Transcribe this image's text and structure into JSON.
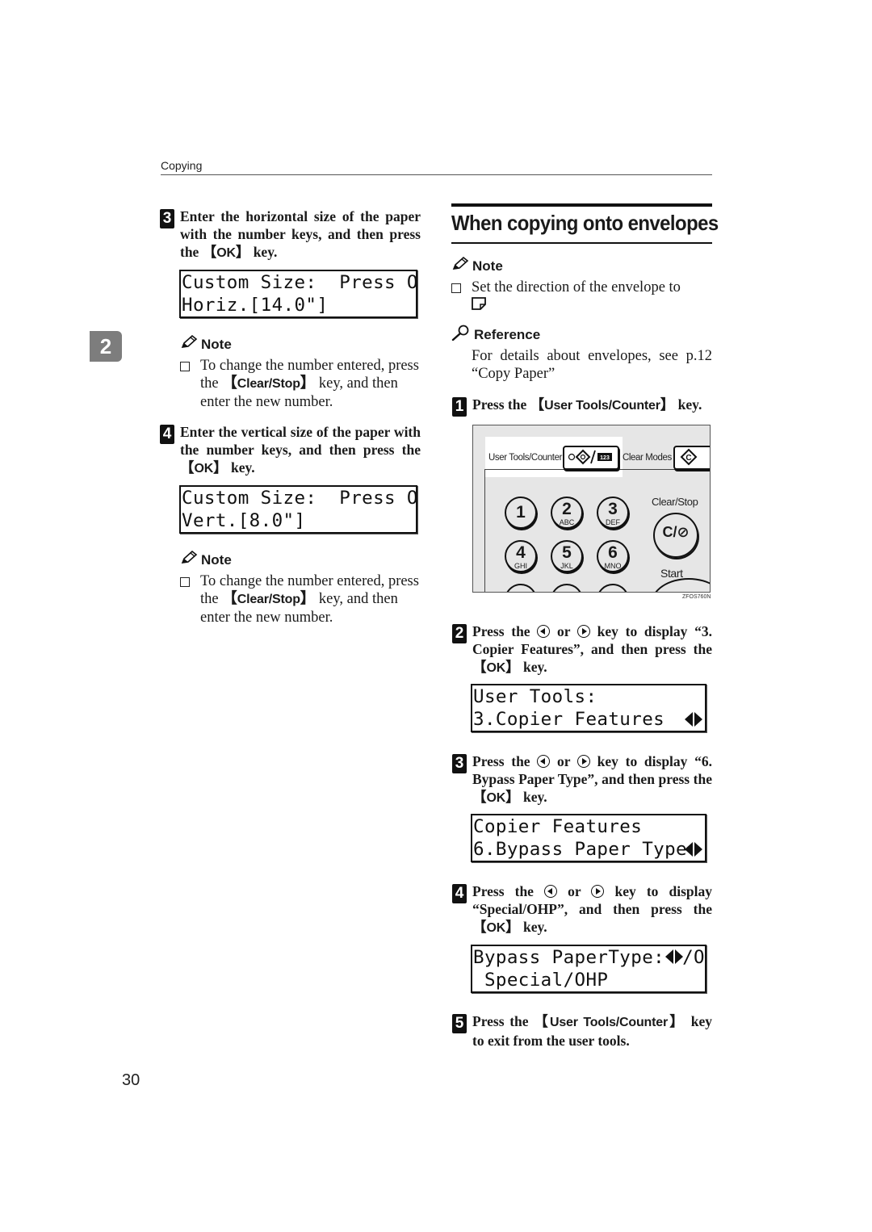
{
  "header": {
    "running_title": "Copying",
    "chapter_tab": "2"
  },
  "left_column": {
    "step3": {
      "number": "3",
      "text_before": "Enter the horizontal size of the paper with the number keys, and then press the ",
      "key": "OK",
      "text_after": " key.",
      "lcd": {
        "line1": "Custom Size:  Press OK",
        "line2": "Horiz.[14.0\"]"
      }
    },
    "note1": {
      "title": "Note",
      "text_before": "To change the number entered, press the ",
      "key": "Clear/Stop",
      "text_after": " key, and then enter the new number."
    },
    "step4": {
      "number": "4",
      "text_before": "Enter the vertical size of the paper with the number keys, and then press the ",
      "key": "OK",
      "text_after": " key.",
      "lcd": {
        "line1": "Custom Size:  Press OK",
        "line2": "Vert.[8.0\"]"
      }
    },
    "note2": {
      "title": "Note",
      "text_before": "To change the number entered, press the ",
      "key": "Clear/Stop",
      "text_after": " key, and then enter the new number."
    }
  },
  "right_column": {
    "section_title": "When copying onto envelopes",
    "note": {
      "title": "Note",
      "text": "Set the direction of the envelope to",
      "icon": "envelope-orientation-icon"
    },
    "reference": {
      "title": "Reference",
      "text": "For details about envelopes, see p.12 “Copy Paper”"
    },
    "step1": {
      "number": "1",
      "text_before": "Press the ",
      "key": "User Tools/Counter",
      "text_after": " key."
    },
    "panel": {
      "user_tools_label": "User Tools/Counter",
      "counter_badge": "123",
      "clear_modes_label": "Clear Modes",
      "clear_stop_label": "Clear/Stop",
      "clear_stop_key": "C/⊘",
      "start_label": "Start",
      "figure_id": "ZFOS760N",
      "keys": [
        {
          "n": "1",
          "l": ""
        },
        {
          "n": "2",
          "l": "ABC"
        },
        {
          "n": "3",
          "l": "DEF"
        },
        {
          "n": "4",
          "l": "GHI"
        },
        {
          "n": "5",
          "l": "JKL"
        },
        {
          "n": "6",
          "l": "MNO"
        }
      ]
    },
    "step2": {
      "number": "2",
      "text_a": "Press the ",
      "text_b": " or ",
      "text_c": " key to display “3. Copier Features”, and then press the ",
      "key": "OK",
      "text_after": " key.",
      "lcd": {
        "line1": "User Tools:",
        "line2": "3.Copier Features  "
      }
    },
    "step3": {
      "number": "3",
      "text_a": "Press the ",
      "text_b": " or ",
      "text_c": " key to display “6. Bypass Paper Type”, and then press the ",
      "key": "OK",
      "text_after": " key.",
      "lcd": {
        "line1": "Copier Features",
        "line2": "6.Bypass Paper Type "
      }
    },
    "step4": {
      "number": "4",
      "text_a": "Press the ",
      "text_b": " or ",
      "text_c": " key to display “Special/OHP”, and then press the ",
      "key": "OK",
      "text_after": " key.",
      "lcd": {
        "line1a": "Bypass PaperType:",
        "line1b": "/OK",
        "line2": " Special/OHP"
      }
    },
    "step5": {
      "number": "5",
      "text_before": "Press the ",
      "key": "User Tools/Counter",
      "text_after": " key to exit from the user tools."
    }
  },
  "footer": {
    "page_number": "30"
  }
}
